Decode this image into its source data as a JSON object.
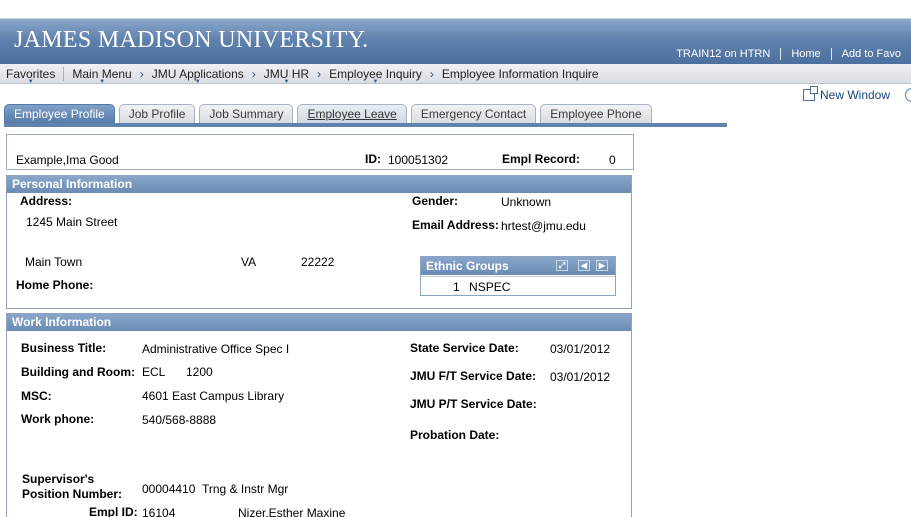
{
  "banner": {
    "title": "JAMES MADISON UNIVERSITY.",
    "environment": "TRAIN12 on HTRN",
    "home_link": "Home",
    "favorites_link": "Add to Favo"
  },
  "nav": {
    "favorites": "Favorites",
    "main_menu": "Main Menu",
    "crumbs": [
      "JMU Applications",
      "JMU HR",
      "Employee Inquiry",
      "Employee Information Inquire"
    ]
  },
  "new_window": "New Window",
  "tabs": [
    "Employee Profile",
    "Job Profile",
    "Job Summary",
    "Employee Leave",
    "Emergency Contact",
    "Employee Phone"
  ],
  "header": {
    "name": "Example,Ima Good",
    "id_label": "ID:",
    "id": "100051302",
    "empl_record_label": "Empl Record:",
    "empl_record": "0"
  },
  "personal": {
    "title": "Personal Information",
    "address_label": "Address:",
    "address_line1": "1245 Main Street",
    "city": "Main Town",
    "state": "VA",
    "zip": "22222",
    "home_phone_label": "Home Phone:",
    "gender_label": "Gender:",
    "gender": "Unknown",
    "email_label": "Email Address:",
    "email": "hrtest@jmu.edu",
    "ethnic": {
      "title": "Ethnic Groups",
      "row_num": "1",
      "value": "NSPEC"
    }
  },
  "work": {
    "title": "Work Information",
    "business_title_label": "Business Title:",
    "business_title": "Administrative Office Spec I",
    "building_label": "Building and Room:",
    "building": "ECL",
    "room": "1200",
    "msc_label": "MSC:",
    "msc": "4601 East Campus Library",
    "work_phone_label": "Work phone:",
    "work_phone": "540/568-8888",
    "state_service_label": "State Service Date:",
    "state_service": "03/01/2012",
    "ft_service_label": "JMU F/T Service Date:",
    "ft_service": "03/01/2012",
    "pt_service_label": "JMU P/T Service Date:",
    "probation_label": "Probation Date:",
    "supervisor_label_1": "Supervisor's",
    "supervisor_label_2": "Position Number:",
    "supervisor_position": "00004410",
    "supervisor_title": "Trng & Instr Mgr",
    "empl_id_label": "Empl ID:",
    "empl_id": "16104",
    "supervisor_name": "Nizer,Esther Maxine"
  }
}
